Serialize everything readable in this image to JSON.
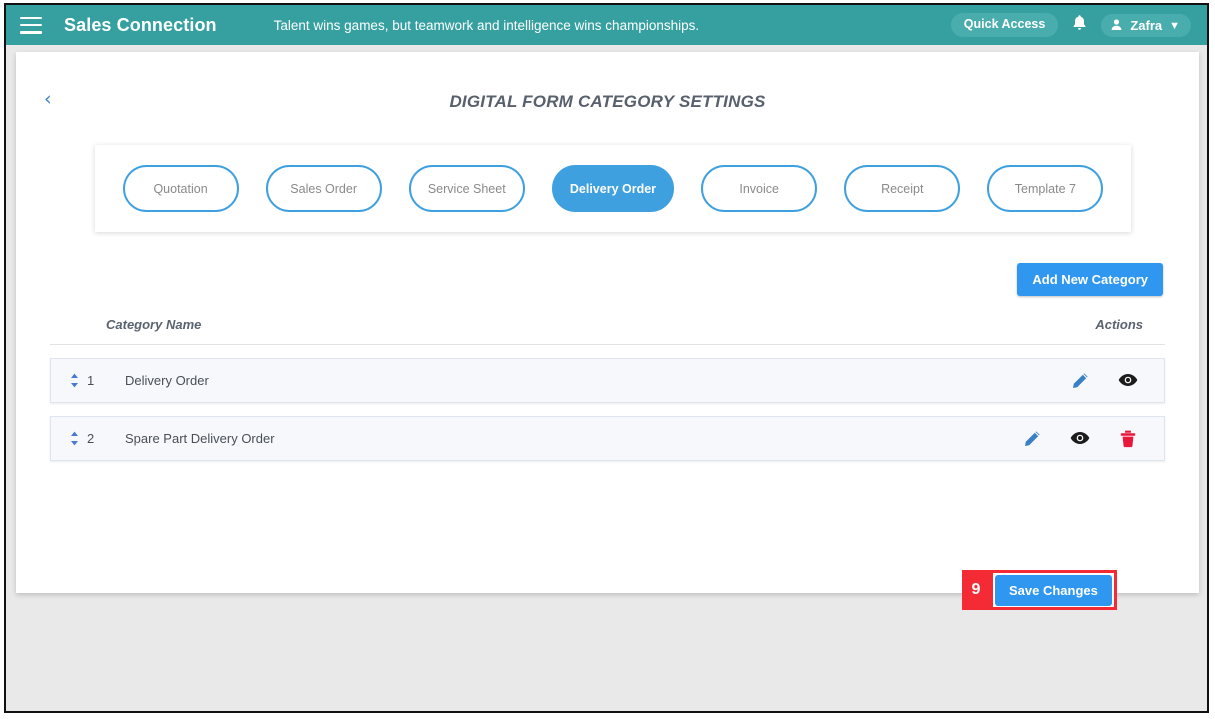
{
  "topbar": {
    "menu_icon": "hamburger-menu-icon",
    "brand": "Sales Connection",
    "tagline": "Talent wins games, but teamwork and intelligence wins championships.",
    "quick_access_label": "Quick Access",
    "bell_icon": "ὑ4",
    "user": {
      "name": "Zafra",
      "person_icon": "person-icon",
      "chevron": "▼"
    },
    "colors": {
      "bar": "#36a0a0",
      "pill": "#4aadad"
    }
  },
  "page": {
    "back_label": "‹",
    "title": "DIGITAL FORM CATEGORY SETTINGS"
  },
  "tabs": [
    {
      "label": "Quotation",
      "active": false
    },
    {
      "label": "Sales Order",
      "active": false
    },
    {
      "label": "Service Sheet",
      "active": false
    },
    {
      "label": "Delivery Order",
      "active": true
    },
    {
      "label": "Invoice",
      "active": false
    },
    {
      "label": "Receipt",
      "active": false
    },
    {
      "label": "Template 7",
      "active": false
    }
  ],
  "toolbar": {
    "add_category_label": "Add New Category",
    "accent_color": "#2f97f0"
  },
  "table": {
    "columns": [
      "Category Name",
      "Actions"
    ],
    "rows": [
      {
        "index": "1",
        "name": "Delivery Order",
        "actions": [
          "edit-icon",
          "view-icon"
        ]
      },
      {
        "index": "2",
        "name": "Spare Part Delivery Order",
        "actions": [
          "edit-icon",
          "view-icon",
          "delete-icon"
        ]
      }
    ]
  },
  "footer": {
    "step_number": "9",
    "save_label": "Save Changes",
    "highlight_color": "#f42b35"
  }
}
